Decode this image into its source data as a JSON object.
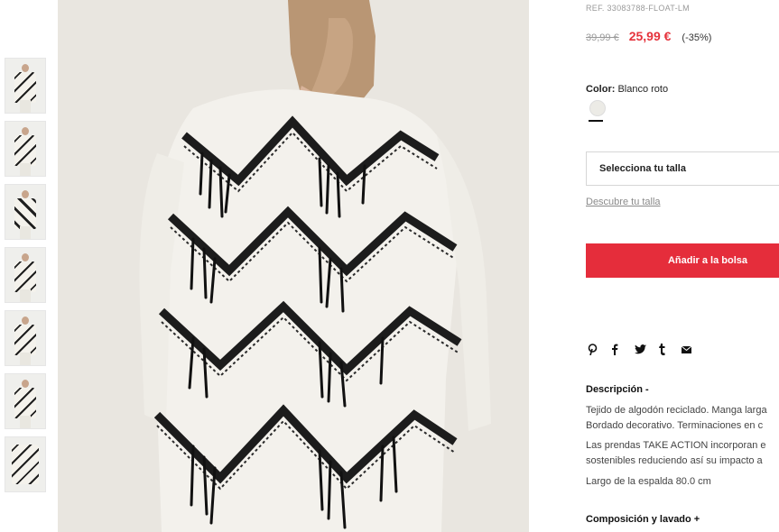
{
  "product": {
    "reference": "REF. 33083788-FLOAT-LM",
    "old_price": "39,99 €",
    "new_price": "25,99 €",
    "discount": "(-35%)",
    "color_label": "Color:",
    "color_value": "Blanco roto"
  },
  "size": {
    "select_label": "Selecciona tu talla",
    "guide_link": "Descubre tu talla"
  },
  "cart": {
    "add_label": "Añadir a la bolsa"
  },
  "share_icons": [
    "pinterest-icon",
    "facebook-icon",
    "twitter-icon",
    "tumblr-icon",
    "email-icon"
  ],
  "description": {
    "title": "Descripción -",
    "line1": "Tejido de algodón reciclado. Manga larga",
    "line2": "Bordado decorativo. Terminaciones en c",
    "line3": "Las prendas TAKE ACTION incorporan e",
    "line4": "sostenibles reduciendo así su impacto a",
    "line5": "Largo de la espalda 80.0 cm"
  },
  "composition": {
    "title": "Composición y lavado +"
  },
  "colors": {
    "accent": "#e52d3b",
    "price_red": "#e5323b",
    "swatch": "#ecebe6"
  }
}
